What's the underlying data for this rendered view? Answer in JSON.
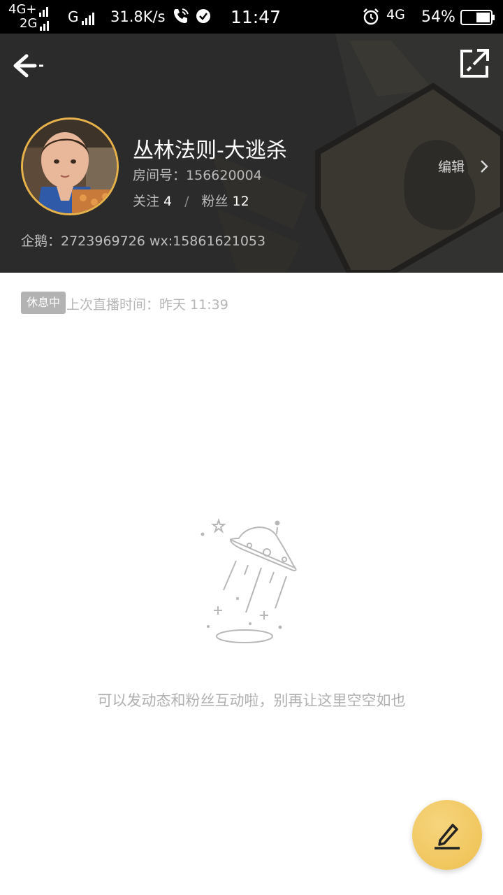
{
  "status_bar": {
    "network1": "4G+",
    "network2": "2G",
    "network3": "G",
    "speed": "31.8K/s",
    "time": "11:47",
    "network4": "4G",
    "battery": "54%"
  },
  "header": {
    "room_name": "丛林法则-大逃杀",
    "room_id_label": "房间号：",
    "room_id": "156620004",
    "follow_label": "关注",
    "follow_count": "4",
    "separator": "/",
    "fans_label": "粉丝",
    "fans_count": "12",
    "edit_label": "编辑",
    "contact": "企鹅：2723969726 wx:15861621053"
  },
  "live_status": {
    "badge": "休息中",
    "last_live": "上次直播时间：昨天 11:39"
  },
  "empty_state": {
    "message": "可以发动态和粉丝互动啦，别再让这里空空如也"
  },
  "colors": {
    "header_bg": "#2b2b2b",
    "accent_gold": "#eebf4f",
    "avatar_border": "#e7b24a",
    "muted_text": "#b0b0b0"
  },
  "icons": {
    "back": "back-arrow-icon",
    "share": "share-icon",
    "edit_chevron": "chevron-right-icon",
    "fab": "compose-icon",
    "empty": "ufo-illustration"
  }
}
